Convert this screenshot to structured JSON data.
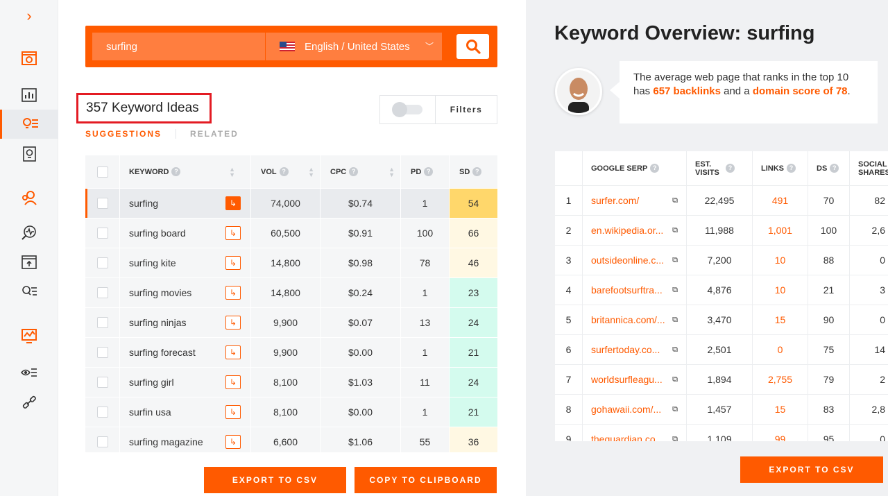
{
  "sidebar": {
    "expand_icon": "chevron-right-icon",
    "items": [
      {
        "name": "site-audit",
        "icon": "browser-search-icon",
        "active": false
      },
      {
        "name": "overview",
        "icon": "bar-chart-icon",
        "active": false
      },
      {
        "name": "keyword-ideas",
        "icon": "lightbulb-list-icon",
        "active": true
      },
      {
        "name": "content-ideas",
        "icon": "lightbulb-doc-icon",
        "active": false
      },
      {
        "name": "competitors",
        "icon": "users-icon",
        "active": false
      },
      {
        "name": "traffic-analyzer",
        "icon": "pulse-search-icon",
        "active": false
      },
      {
        "name": "top-pages",
        "icon": "window-upload-icon",
        "active": false
      },
      {
        "name": "keywords",
        "icon": "search-list-icon",
        "active": false
      },
      {
        "name": "rank-tracking",
        "icon": "monitor-chart-icon",
        "active": false
      },
      {
        "name": "tracking",
        "icon": "eye-list-icon",
        "active": false
      },
      {
        "name": "backlinks",
        "icon": "link-icon",
        "active": false
      }
    ]
  },
  "search": {
    "value": "surfing",
    "language": "English / United States"
  },
  "results": {
    "count_label": "357 Keyword Ideas",
    "filters_label": "Filters",
    "tabs": [
      {
        "label": "SUGGESTIONS",
        "active": true
      },
      {
        "label": "RELATED",
        "active": false
      }
    ]
  },
  "keyword_table": {
    "headers": {
      "keyword": "KEYWORD",
      "vol": "VOL",
      "cpc": "CPC",
      "pd": "PD",
      "sd": "SD"
    },
    "rows": [
      {
        "keyword": "surfing",
        "vol": "74,000",
        "cpc": "$0.74",
        "pd": "1",
        "sd": "54",
        "sd_color": "#ffd76b",
        "selected": true
      },
      {
        "keyword": "surfing board",
        "vol": "60,500",
        "cpc": "$0.91",
        "pd": "100",
        "sd": "66",
        "sd_color": "#fff8e3",
        "selected": false
      },
      {
        "keyword": "surfing kite",
        "vol": "14,800",
        "cpc": "$0.98",
        "pd": "78",
        "sd": "46",
        "sd_color": "#fff8e3",
        "selected": false
      },
      {
        "keyword": "surfing movies",
        "vol": "14,800",
        "cpc": "$0.24",
        "pd": "1",
        "sd": "23",
        "sd_color": "#d4fbee",
        "selected": false
      },
      {
        "keyword": "surfing ninjas",
        "vol": "9,900",
        "cpc": "$0.07",
        "pd": "13",
        "sd": "24",
        "sd_color": "#d4fbee",
        "selected": false
      },
      {
        "keyword": "surfing forecast",
        "vol": "9,900",
        "cpc": "$0.00",
        "pd": "1",
        "sd": "21",
        "sd_color": "#d4fbee",
        "selected": false
      },
      {
        "keyword": "surfing girl",
        "vol": "8,100",
        "cpc": "$1.03",
        "pd": "11",
        "sd": "24",
        "sd_color": "#d4fbee",
        "selected": false
      },
      {
        "keyword": "surfin usa",
        "vol": "8,100",
        "cpc": "$0.00",
        "pd": "1",
        "sd": "21",
        "sd_color": "#d4fbee",
        "selected": false
      },
      {
        "keyword": "surfing magazine",
        "vol": "6,600",
        "cpc": "$1.06",
        "pd": "55",
        "sd": "36",
        "sd_color": "#fff8e3",
        "selected": false
      }
    ]
  },
  "actions": {
    "export_csv": "EXPORT TO CSV",
    "copy_clipboard": "COPY TO CLIPBOARD"
  },
  "overview": {
    "title_bold": "Keyword Overview:",
    "title_keyword": "surfing",
    "bubble_text_1": "The average web page that ranks in the top 10 has ",
    "bubble_backlinks": "657 backlinks",
    "bubble_text_2": " and a ",
    "bubble_domain": "domain score of 78",
    "bubble_text_3": ".",
    "export_csv": "EXPORT TO CSV"
  },
  "serp_table": {
    "headers": {
      "serp": "GOOGLE SERP",
      "visits": "EST. VISITS",
      "links": "LINKS",
      "ds": "DS",
      "social": "SOCIAL SHARES"
    },
    "rows": [
      {
        "rank": "1",
        "url": "surfer.com/",
        "visits": "22,495",
        "links": "491",
        "ds": "70",
        "social": "82"
      },
      {
        "rank": "2",
        "url": "en.wikipedia.or...",
        "visits": "11,988",
        "links": "1,001",
        "ds": "100",
        "social": "2,6"
      },
      {
        "rank": "3",
        "url": "outsideonline.c...",
        "visits": "7,200",
        "links": "10",
        "ds": "88",
        "social": "0"
      },
      {
        "rank": "4",
        "url": "barefootsurftra...",
        "visits": "4,876",
        "links": "10",
        "ds": "21",
        "social": "3"
      },
      {
        "rank": "5",
        "url": "britannica.com/...",
        "visits": "3,470",
        "links": "15",
        "ds": "90",
        "social": "0"
      },
      {
        "rank": "6",
        "url": "surfertoday.co...",
        "visits": "2,501",
        "links": "0",
        "ds": "75",
        "social": "14"
      },
      {
        "rank": "7",
        "url": "worldsurfleagu...",
        "visits": "1,894",
        "links": "2,755",
        "ds": "79",
        "social": "2"
      },
      {
        "rank": "8",
        "url": "gohawaii.com/...",
        "visits": "1,457",
        "links": "15",
        "ds": "83",
        "social": "2,8"
      },
      {
        "rank": "9",
        "url": "theguardian.co...",
        "visits": "1,109",
        "links": "99",
        "ds": "95",
        "social": "0"
      }
    ]
  },
  "colors": {
    "accent": "#ff5a00",
    "highlight_box": "#e31b23"
  }
}
